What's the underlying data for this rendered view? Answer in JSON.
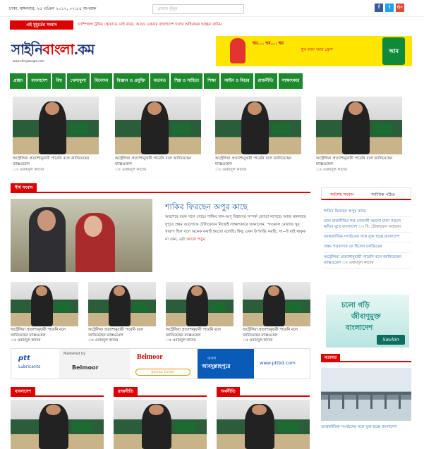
{
  "topbar": {
    "date": "ঢাকা: মঙ্গলবার, ২৫ এপ্রিল ২০১৭, ০৭:৫৫ অপরাহ্ন",
    "search_placeholder": "এখানে খুঁজুন",
    "social": [
      {
        "name": "facebook-icon",
        "glyph": "f",
        "color": "#3b5998"
      },
      {
        "name": "twitter-icon",
        "glyph": "t",
        "color": "#1da1f2"
      },
      {
        "name": "googleplus-icon",
        "glyph": "G+",
        "color": "#dd4b39"
      }
    ]
  },
  "ticker": {
    "label": "এই মুহূর্তের সংবাদ",
    "text": "চ্যাম্পিয়ন্স ট্রফির স্কোয়াডে নেই বাবর, আরও একবার বাংলাদেশ দলের অধিনায়ক হচ্ছেন তামিম"
  },
  "logo": {
    "text_a": "সাইনি",
    "text_b": "বাংলা",
    "text_c": ".কম",
    "url": "www.shinybangla.com"
  },
  "ad_top": {
    "bubble": "হুম.... হুম.... হুম",
    "line": "খুব মজা আর ফ্রেশ",
    "pack": "আম"
  },
  "nav": {
    "items": [
      "প্রচ্ছদ",
      "বাংলাদেশ",
      "বিশ্ব",
      "খেলাধুলা",
      "বিনোদন",
      "বিজ্ঞান ও প্রযুক্তি",
      "মতামত",
      "শিল্প ও সাহিত্য",
      "শিক্ষা",
      "আইন ও বিচার",
      "রাজনীতি",
      "সাক্ষাৎকার"
    ]
  },
  "slider": [
    {
      "title": "অস্ট্রেলিয়া প্রত্যাশানুযায়ী পারেনি বলে জানিয়েছেন ম্যাক্সওয়েল",
      "by": "ঃ ওবায়দুল কাদের"
    },
    {
      "title": "অস্ট্রেলিয়া প্রত্যাশানুযায়ী পারেনি বলে জানিয়েছেন ম্যাক্সওয়েল",
      "by": "ঃ ওবায়দুল কাদের"
    },
    {
      "title": "অস্ট্রেলিয়া প্রত্যাশানুযায়ী পারেনি বলে জানিয়েছেন ম্যাক্সওয়েল",
      "by": "ঃ ওবায়দুল কাদের"
    },
    {
      "title": "অস্ট্রেলিয়া প্রত্যাশানুযায়ী পারেনি বলে জানিয়েছেন ম্যাক্সওয়েল",
      "by": "ঃ ওবায়দুল কাদের"
    }
  ],
  "lead": {
    "section": "শীর্ষ সংবাদ",
    "title": "শাকিব ফিরছেন অপুর কাছে",
    "body": "অবশেষে বরফ গলে গেছে। শাকিব খান-অপু বিশ্বাসের সম্পর্ক জোড়া লাগছে। আজ মঙ্গলবার দুপুরে প্রথম আলোকে টেলিফোনে নিজেই সাক্ষাৎকারে জানালেন, 'গতকাল মেজাজ খুব খারাপ ছিল বলে অনেক কথাই হয়তো বলেছি। কিছু এখন উপলব্ধি করছি, সা—ই যাই থাকুক না কেন, এটা",
    "more": "আরো পড়ুন"
  },
  "grid4": [
    {
      "title": "অস্ট্রেলিয়া প্রত্যাশানুযায়ী পারেনি বলে জানিয়েছেন ম্যাক্সওয়েল",
      "by": "ঃ ওবায়দুল কাদের"
    },
    {
      "title": "অস্ট্রেলিয়া প্রত্যাশানুযায়ী পারেনি বলে জানিয়েছেন ম্যাক্সওয়েল",
      "by": "ঃ ওবায়দুল কাদের"
    },
    {
      "title": "অস্ট্রেলিয়া প্রত্যাশানুযায়ী পারেনি বলে জানিয়েছেন ম্যাক্সওয়েল",
      "by": "ঃ ওবায়দুল কাদের"
    },
    {
      "title": "অস্ট্রেলিয়া প্রত্যাশানুযায়ী পারেনি বলে জানিয়েছেন ম্যাক্সওয়েল",
      "by": "ঃ ওবায়দুল কাদের"
    }
  ],
  "banner": {
    "brand": "ptt",
    "brand_sub": "Lubricants",
    "marketed": "Marketed by",
    "marketer": "Belmoor",
    "belmoor": "Belmoor",
    "service": "Service Center",
    "now": "এখন",
    "place": "আবদুল্লাহপুরে",
    "url": "www.pttbd.com"
  },
  "bottom_sections": [
    "বাংলাদেশ",
    "রাজনীতি",
    "অর্থনীতি"
  ],
  "sidebar": {
    "tab_latest": "সর্বশেষ সংবাদ",
    "tab_popular": "সর্বাধিক পঠিত",
    "items": [
      {
        "title": "শাকিব ফিরছেন অপুর কাছে",
        "by": ""
      },
      {
        "title": "ভাল রাজনীতির শর্ত সোনালী আলো ঢাকা পড়লে ক্ষতির মুখে বাংলাদেশ",
        "by": "ঃ বি. টোফায়েল আহমেদ"
      },
      {
        "title": "আন্তর্জাতিক সংগঠনের সঙ্গে যুক্ত হচ্ছে বাংলাদেশ",
        "by": ""
      },
      {
        "title": "প্রথম গডফাদার কে ছিলেন চলচ্চিত্রের",
        "by": ""
      },
      {
        "title": "অস্ট্রেলিয়া প্রত্যাশানুযায়ী পারেনি বলে জানিয়েছেন ম্যাক্সওয়েল",
        "by": "ঃ ওবায়দুল কাদের"
      }
    ]
  },
  "savlon": {
    "l1": "চলো গড়ি",
    "l2": "জীবাণুমুক্ত",
    "l3": "বাংলাদেশ",
    "brand": "Savlon"
  },
  "side_section": {
    "label": "মতামত",
    "caption": "আন্তর্জাতিক সংগঠনের সঙ্গে যুক্ত হচ্ছে বাংলাদেশ"
  }
}
